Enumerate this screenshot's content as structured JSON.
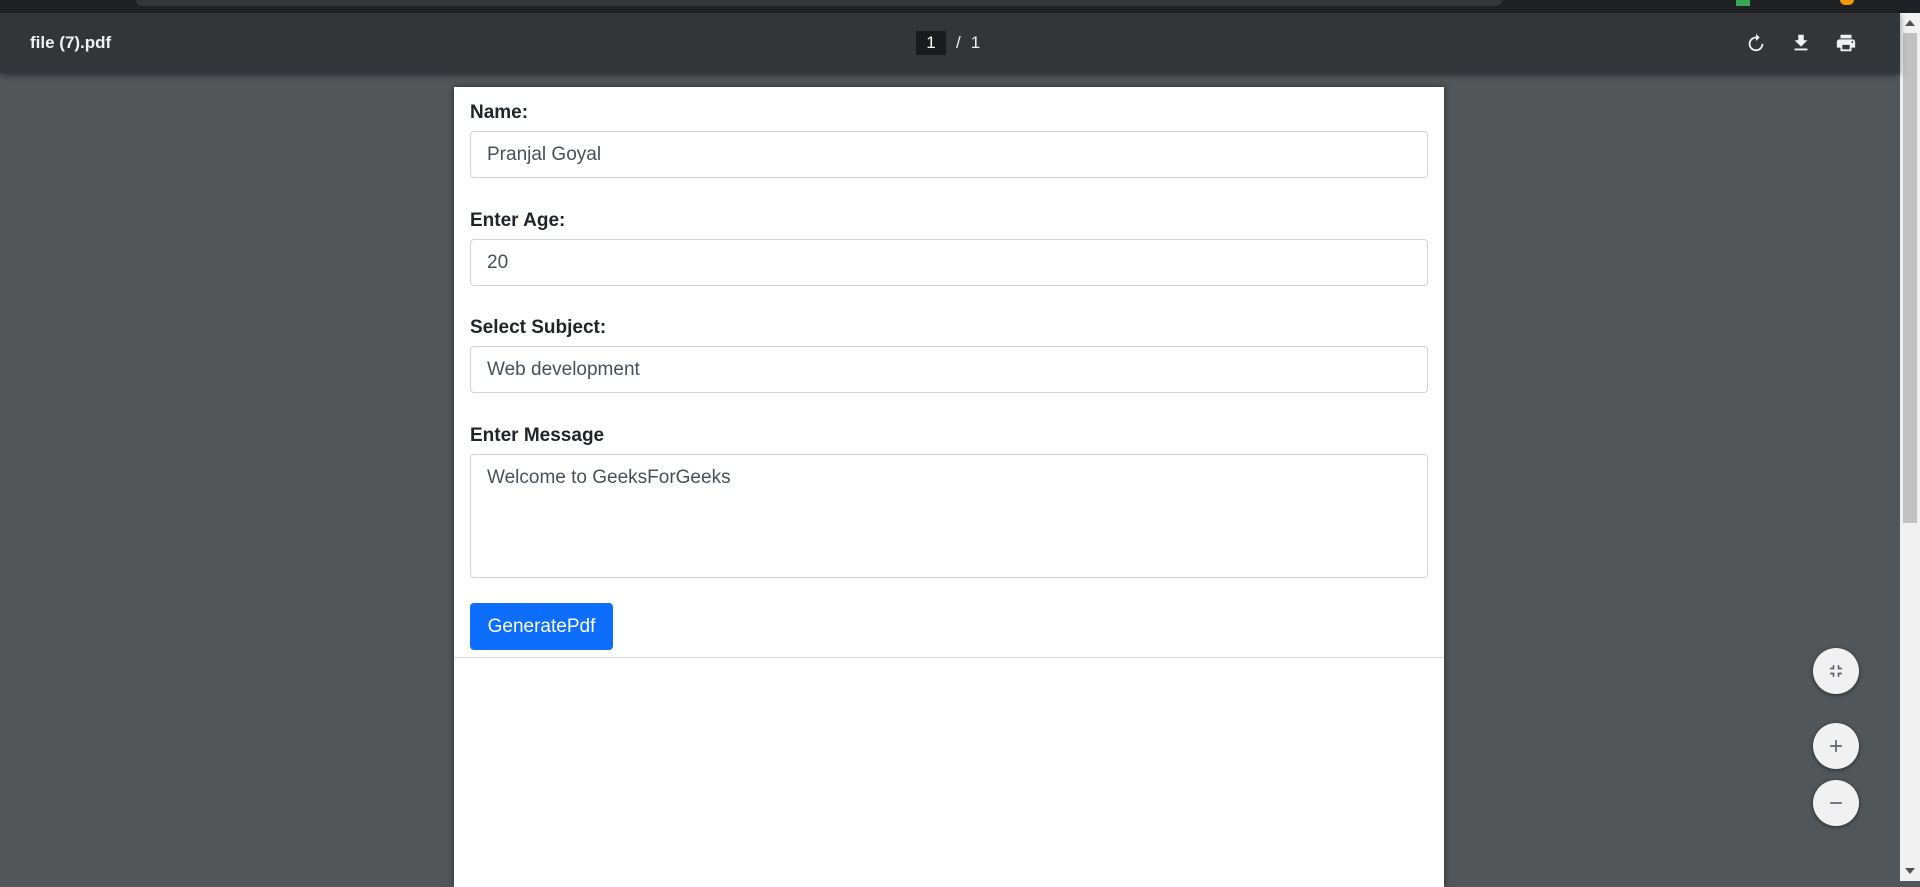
{
  "viewer": {
    "title": "file (7).pdf",
    "current_page": "1",
    "separator": "/",
    "total_pages": "1"
  },
  "toolbar_icons": {
    "rotate": "rotate-icon",
    "download": "download-icon",
    "print": "print-icon"
  },
  "form": {
    "name_label": "Name:",
    "name_value": "Pranjal Goyal",
    "age_label": "Enter Age:",
    "age_value": "20",
    "subject_label": "Select Subject:",
    "subject_value": "Web development",
    "message_label": "Enter Message",
    "message_value": "Welcome to GeeksForGeeks",
    "button_label": "GeneratePdf"
  },
  "zoom_controls": {
    "fit": "fit-to-page-icon",
    "zoom_in": "zoom-in-icon",
    "zoom_out": "zoom-out-icon"
  },
  "colors": {
    "toolbar": "#323639",
    "background": "#525659",
    "primary_button": "#0d6efd"
  }
}
